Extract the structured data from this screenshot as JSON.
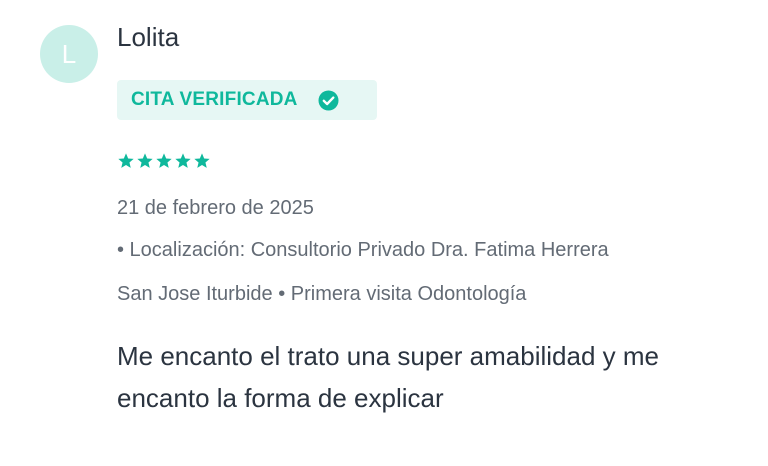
{
  "review": {
    "avatar_letter": "L",
    "author_name": "Lolita",
    "badge_label": "CITA VERIFICADA",
    "rating": 5,
    "rating_max": 5,
    "date": "21 de febrero de 2025",
    "location_line1": "• Localización: Consultorio Privado Dra. Fatima Herrera",
    "location_line2": "San Jose Iturbide • Primera visita Odontología",
    "comment": "Me encanto el trato una super amabilidad y me encanto la forma de explicar"
  },
  "colors": {
    "accent": "#0fb89c",
    "badge_bg": "#e6f7f4",
    "avatar_bg": "#c9efe8",
    "text_primary": "#2b3440",
    "text_secondary": "#636b75"
  },
  "icons": {
    "verified": "check-circle-icon",
    "rating": "star-icon"
  }
}
